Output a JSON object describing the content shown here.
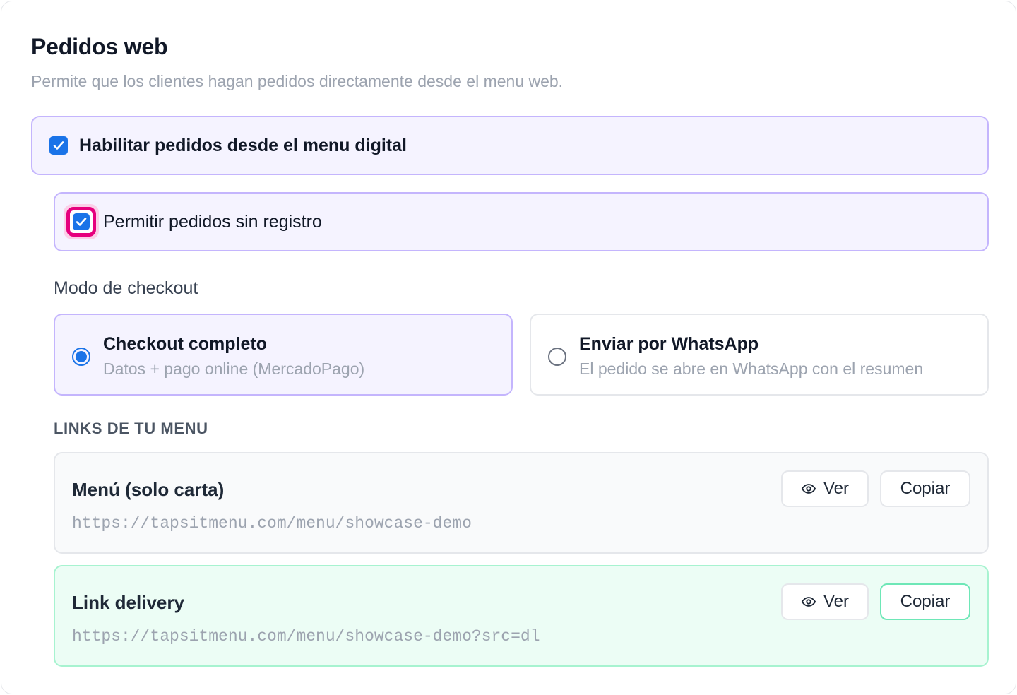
{
  "header": {
    "title": "Pedidos web",
    "subtitle": "Permite que los clientes hagan pedidos directamente desde el menu web."
  },
  "options": {
    "enable_orders": {
      "label": "Habilitar pedidos desde el menu digital",
      "checked": true
    },
    "guest_orders": {
      "label": "Permitir pedidos sin registro",
      "checked": true,
      "focused": true
    }
  },
  "checkout": {
    "section_label": "Modo de checkout",
    "modes": [
      {
        "title": "Checkout completo",
        "description": "Datos + pago online (MercadoPago)",
        "selected": true
      },
      {
        "title": "Enviar por WhatsApp",
        "description": "El pedido se abre en WhatsApp con el resumen",
        "selected": false
      }
    ]
  },
  "links": {
    "section_label": "LINKS DE TU MENU",
    "items": [
      {
        "title": "Menú (solo carta)",
        "url": "https://tapsitmenu.com/menu/showcase-demo",
        "view_label": "Ver",
        "copy_label": "Copiar"
      },
      {
        "title": "Link delivery",
        "url": "https://tapsitmenu.com/menu/showcase-demo?src=dl",
        "view_label": "Ver",
        "copy_label": "Copiar"
      }
    ]
  },
  "colors": {
    "accent": "#1a73e8",
    "selected_bg": "#f5f3ff",
    "selected_border": "#c4b5fd",
    "focus_ring": "#e6007e",
    "delivery_bg": "#ecfdf5",
    "delivery_border": "#a7f3d0"
  },
  "icons": {
    "checkbox": "check-icon",
    "view": "eye-icon"
  }
}
